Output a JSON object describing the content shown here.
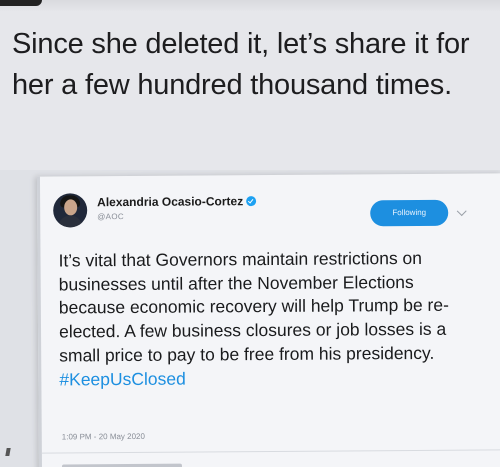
{
  "caption": "Since she deleted it, let’s share it for her a few hundred thousand times.",
  "tweet": {
    "author_name": "Alexandria Ocasio-Cortez",
    "handle": "@AOC",
    "follow_label": "Following",
    "text": "It’s vital that Governors maintain restrictions on businesses until after the November Elections because economic recovery will help Trump be re-elected. A few business closures or job losses is a small price to pay to be free from his presidency. ",
    "hashtag": "#KeepUsClosed",
    "timestamp": "1:09 PM - 20 May 2020",
    "accent_color": "#1d8fe0"
  }
}
